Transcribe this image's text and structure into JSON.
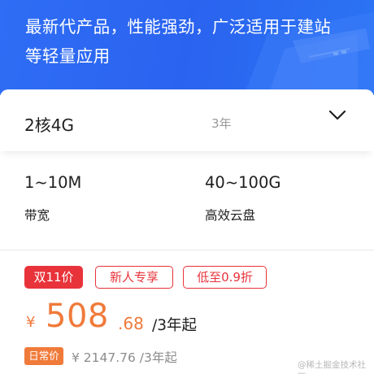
{
  "banner": {
    "line1": "最新代产品，性能强劲，广泛适用于建站",
    "line2": "等轻量应用"
  },
  "config": {
    "spec": "2核4G",
    "term": "3年",
    "dropdown_icon": "chevron-down-icon"
  },
  "specs": [
    {
      "value": "1~10M",
      "label": "带宽"
    },
    {
      "value": "40~100G",
      "label": "高效云盘"
    }
  ],
  "tags": [
    "双11价",
    "新人专享",
    "低至0.9折"
  ],
  "price": {
    "currency": "¥",
    "integer": "508",
    "decimal": ".68",
    "unit": "/3年起"
  },
  "regular": {
    "badge": "日常价",
    "price": "¥ 2147.76 /3年起"
  },
  "watermark": "@稀土掘金技术社区",
  "colors": {
    "banner_blue": "#2f6df5",
    "tag_red": "#e8333a",
    "price_orange": "#f07a3a"
  }
}
